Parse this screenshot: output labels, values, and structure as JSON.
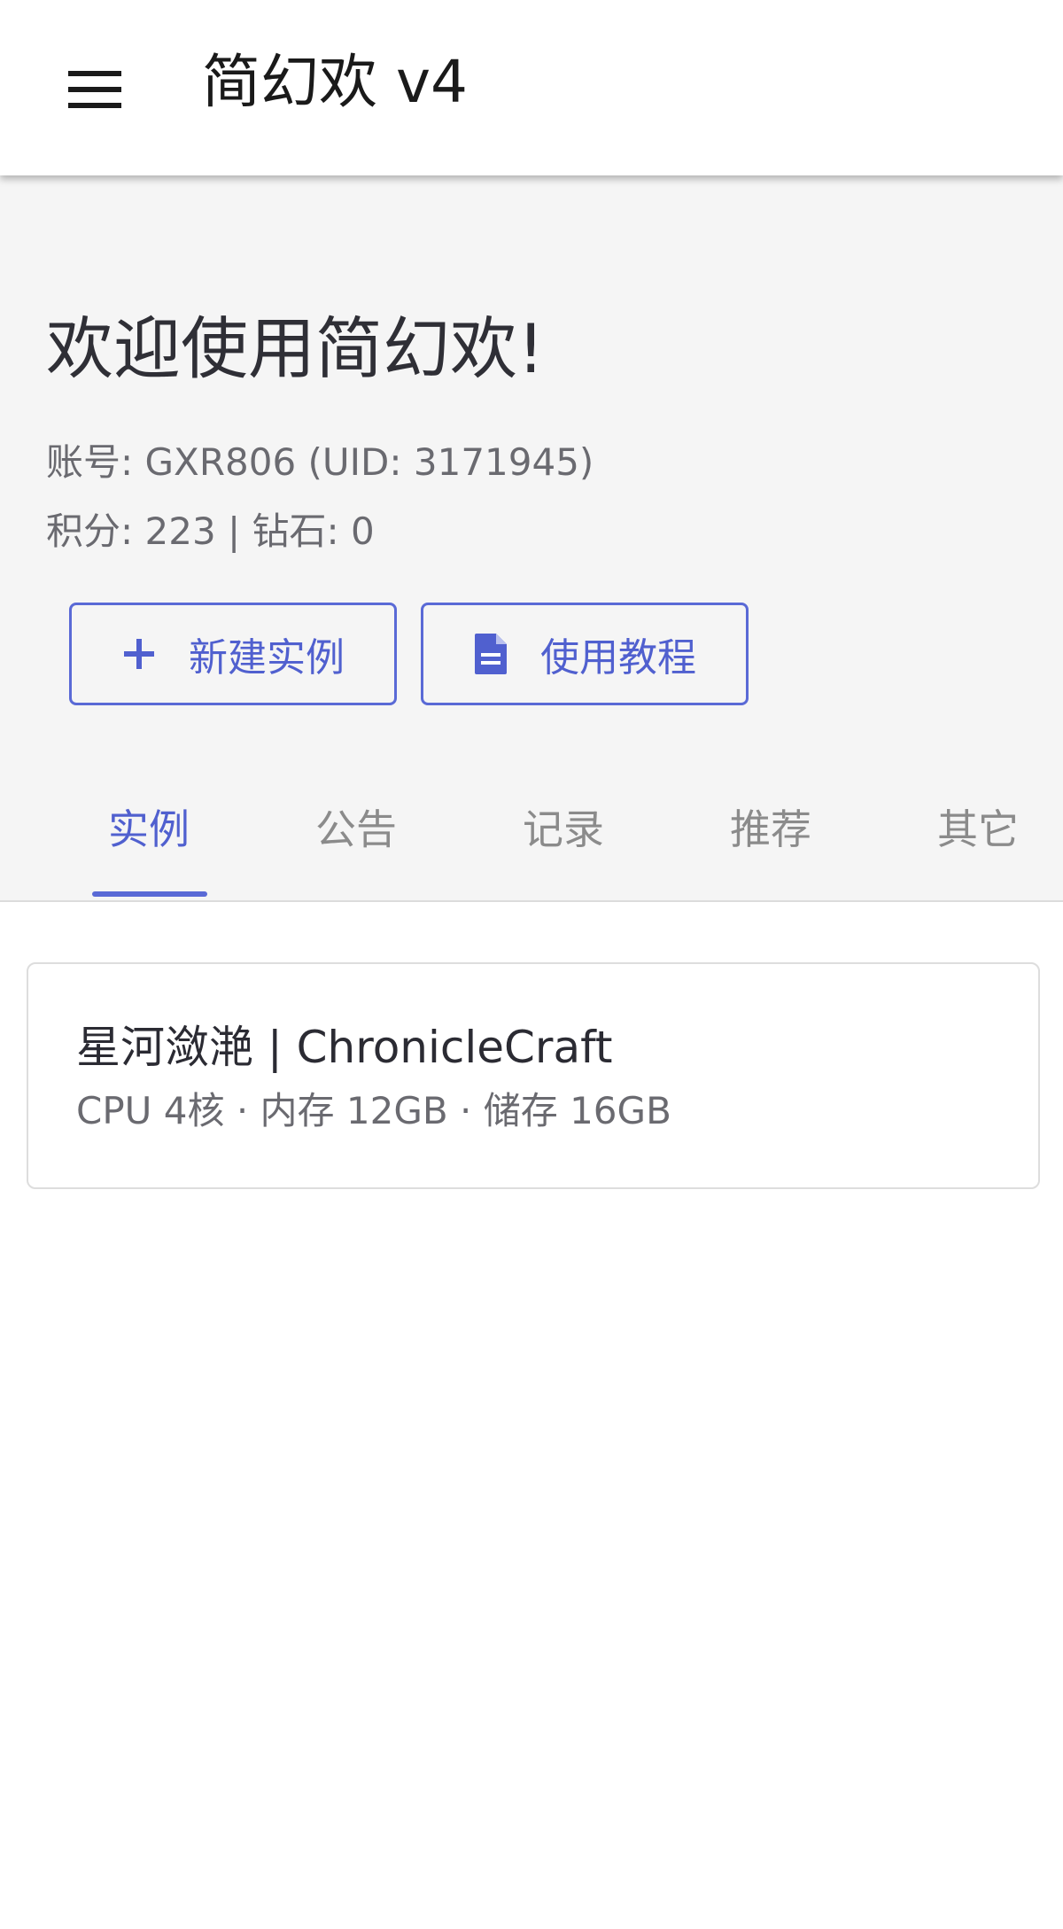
{
  "appbar": {
    "menu_icon": "hamburger-menu-icon",
    "title": "简幻欢 v4"
  },
  "hero": {
    "welcome": "欢迎使用简幻欢!",
    "account_line": "账号: GXR806 (UID: 3171945)",
    "points_line": "积分: 223 | 钻石: 0"
  },
  "actions": {
    "new_instance": {
      "label": "新建实例",
      "icon": "plus-icon"
    },
    "guide": {
      "label": "使用教程",
      "icon": "document-icon"
    }
  },
  "tabs": [
    {
      "label": "实例",
      "active": true
    },
    {
      "label": "公告",
      "active": false
    },
    {
      "label": "记录",
      "active": false
    },
    {
      "label": "推荐",
      "active": false
    },
    {
      "label": "其它",
      "active": false
    }
  ],
  "instances": [
    {
      "name": "星河潋滟 | ChronicleCraft",
      "spec": "CPU 4核 · 内存 12GB · 储存 16GB"
    }
  ],
  "colors": {
    "accent": "#5a6ad6",
    "hero_bg": "#f5f5f5",
    "inactive_tab": "#8b8b8b"
  }
}
